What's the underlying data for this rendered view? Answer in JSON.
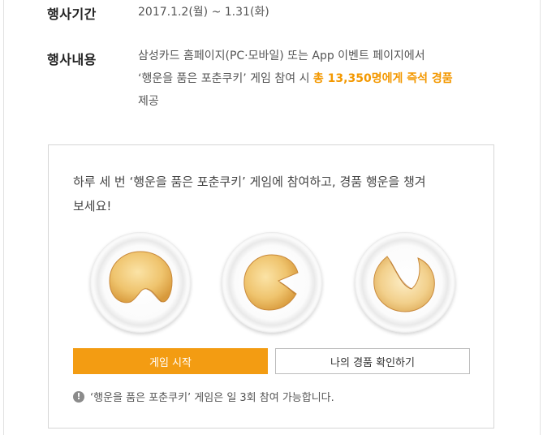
{
  "event": {
    "period_label": "행사기간",
    "period_value": "2017.1.2(월) ~ 1.31(화)",
    "content_label": "행사내용",
    "content_line1": "삼성카드 홈페이지(PC·모바일) 또는 App 이벤트 페이지에서",
    "content_line2_prefix": "‘행운을 품은 포춘쿠키’ 게임 참여 시 ",
    "content_line2_highlight": "총 13,350명에게 즉석 경품",
    "content_line3": "제공"
  },
  "game": {
    "intro_line1": "하루 세 번 ‘행운을 품은 포춘쿠키’ 게임에 참여하고, 경품 행운을 챙겨",
    "intro_line2": "보세요!",
    "cookies": [
      {
        "icon": "fortune-cookie-icon"
      },
      {
        "icon": "fortune-cookie-icon"
      },
      {
        "icon": "fortune-cookie-icon"
      }
    ],
    "start_button": "게임 시작",
    "prize_button": "나의 경품 확인하기",
    "notice_icon": "!",
    "notice_text": "‘행운을 품은 포춘쿠키’ 게임은 일 3회 참여 가능합니다."
  },
  "colors": {
    "accent": "#f39c12",
    "highlight": "#f39800"
  }
}
